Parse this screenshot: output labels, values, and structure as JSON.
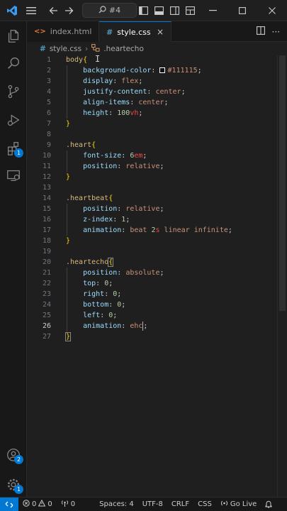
{
  "titlebar": {
    "search_text": "#4",
    "icons": [
      "vscode-logo",
      "menu-icon",
      "back-arrow-icon",
      "forward-arrow-icon",
      "search-icon",
      "layout-sidebar-icon",
      "layout-panel-icon",
      "layout-secondary-icon",
      "customize-layout-icon"
    ]
  },
  "activity": {
    "extensions_badge": "1",
    "accounts_badge": "2",
    "settings_badge": "1"
  },
  "tabs": [
    {
      "label": "index.html",
      "icon": "<>",
      "active": false
    },
    {
      "label": "style.css",
      "icon": "#",
      "active": true,
      "close": "×"
    }
  ],
  "breadcrumb": {
    "file": "style.css",
    "separator": "›",
    "symbol": ".heartecho"
  },
  "editor": {
    "line_numbers": [
      "1",
      "2",
      "3",
      "4",
      "5",
      "6",
      "7",
      "8",
      "9",
      "10",
      "11",
      "12",
      "13",
      "14",
      "15",
      "16",
      "17",
      "18",
      "19",
      "20",
      "21",
      "22",
      "23",
      "24",
      "25",
      "26",
      "27"
    ],
    "current_line": "26",
    "tokens": {
      "l1_sel": "body",
      "l1_brace": "{",
      "l2_prop": "background-color",
      "l2_val": "#111115",
      "l3_prop": "display",
      "l3_val": "flex",
      "l4_prop": "justify-content",
      "l4_val": "center",
      "l5_prop": "align-items",
      "l5_val": "center",
      "l6_prop": "height",
      "l6_num": "100",
      "l6_unit": "vh",
      "l7_brace": "}",
      "l9_sel": ".heart",
      "l9_brace": "{",
      "l10_prop": "font-size",
      "l10_num": "6",
      "l10_unit": "em",
      "l11_prop": "position",
      "l11_val": "relative",
      "l12_brace": "}",
      "l14_sel": ".heartbeat",
      "l14_brace": "{",
      "l15_prop": "position",
      "l15_val": "relative",
      "l16_prop": "z-index",
      "l16_num": "1",
      "l17_prop": "animation",
      "l17_v1": "beat",
      "l17_num": "2",
      "l17_unit": "s",
      "l17_v2": "linear infinite",
      "l18_brace": "}",
      "l20_sel": ".heartecho",
      "l20_brace": "{",
      "l21_prop": "position",
      "l21_val": "absolute",
      "l22_prop": "top",
      "l22_num": "0",
      "l23_prop": "right",
      "l23_num": "0",
      "l24_prop": "bottom",
      "l24_num": "0",
      "l25_prop": "left",
      "l25_num": "0",
      "l26_prop": "animation",
      "l26_val": "ehc",
      "l27_brace": "}"
    }
  },
  "statusbar": {
    "errors": "0",
    "warnings": "0",
    "ports": "0",
    "spaces": "Spaces: 4",
    "encoding": "UTF-8",
    "eol": "CRLF",
    "language": "CSS",
    "go_live": "Go Live"
  },
  "colors": {
    "accent": "#0078d4",
    "editor_bg": "#1f1f1f",
    "sidebar_bg": "#181818"
  }
}
